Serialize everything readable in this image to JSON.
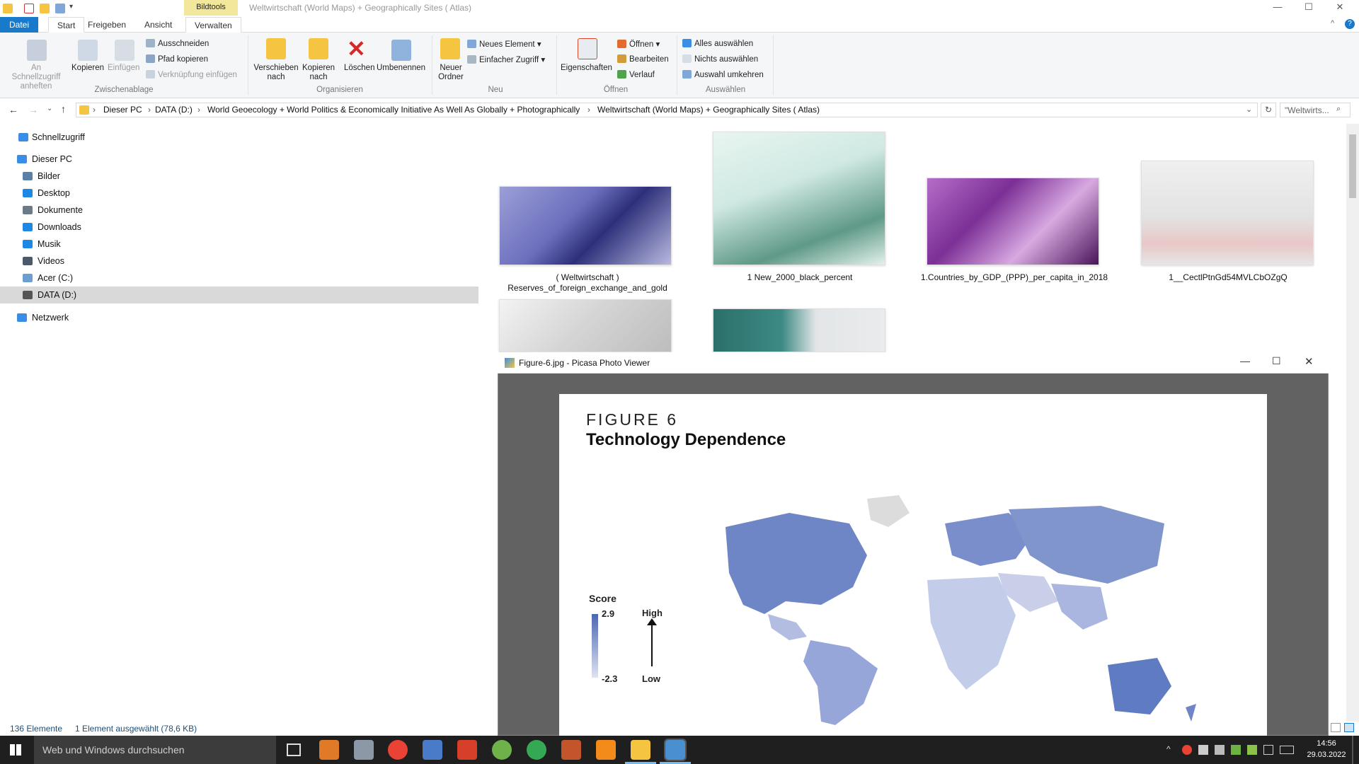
{
  "titlebar": {
    "context_tab": "Bildtools",
    "window_title": "Weltwirtschaft (World Maps) + Geographically Sites ( Atlas)",
    "minimize": "—",
    "maximize": "☐",
    "close": "✕"
  },
  "tabs": [
    "Datei",
    "Start",
    "Freigeben",
    "Ansicht",
    "Verwalten"
  ],
  "ribbon": {
    "pin": "An Schnellzugriff anheften",
    "copy": "Kopieren",
    "paste": "Einfügen",
    "cut": "Ausschneiden",
    "copy_path": "Pfad kopieren",
    "paste_shortcut": "Verknüpfung einfügen",
    "group_clipboard": "Zwischenablage",
    "move_to": "Verschieben nach",
    "copy_to": "Kopieren nach",
    "delete": "Löschen",
    "rename": "Umbenennen",
    "group_organize": "Organisieren",
    "new_folder": "Neuer Ordner",
    "new_item": "Neues Element",
    "easy_access": "Einfacher Zugriff",
    "group_new": "Neu",
    "properties": "Eigenschaften",
    "open": "Öffnen",
    "edit": "Bearbeiten",
    "history": "Verlauf",
    "group_open": "Öffnen",
    "select_all": "Alles auswählen",
    "select_none": "Nichts auswählen",
    "invert_selection": "Auswahl umkehren",
    "group_select": "Auswählen"
  },
  "address": {
    "crumbs": [
      "Dieser PC",
      "DATA (D:)",
      "World Geoecology + World Politics & Economically Initiative As Well As Globally + Photographically",
      "Weltwirtschaft (World Maps) + Geographically Sites ( Atlas)"
    ],
    "search_placeholder": "\"Weltwirts..."
  },
  "nav": {
    "items": [
      {
        "label": "Schnellzugriff",
        "icon": "star-icon",
        "color": "#3a8ee6"
      },
      {
        "label": "Dieser PC",
        "icon": "pc-icon",
        "color": "#3a8ee6"
      },
      {
        "label": "Bilder",
        "icon": "pictures-icon",
        "color": "#5a7fa8"
      },
      {
        "label": "Desktop",
        "icon": "desktop-icon",
        "color": "#1e88e5"
      },
      {
        "label": "Dokumente",
        "icon": "documents-icon",
        "color": "#6d7a87"
      },
      {
        "label": "Downloads",
        "icon": "download-icon",
        "color": "#1e88e5"
      },
      {
        "label": "Musik",
        "icon": "music-icon",
        "color": "#1e88e5"
      },
      {
        "label": "Videos",
        "icon": "videos-icon",
        "color": "#4a5a6a"
      },
      {
        "label": "Acer (C:)",
        "icon": "drive-icon",
        "color": "#6a9fd0"
      },
      {
        "label": "DATA (D:)",
        "icon": "drive-icon",
        "color": "#555555"
      },
      {
        "label": "Netzwerk",
        "icon": "network-icon",
        "color": "#3a8ee6"
      }
    ]
  },
  "files": [
    {
      "caption": "( Weltwirtschaft )\nReserves_of_foreign_exchange_and_gold",
      "tint": "#6b6fb8"
    },
    {
      "caption": "1 New_2000_black_percent",
      "tint": "#cfe9e2"
    },
    {
      "caption": "1.Countries_by_GDP_(PPP)_per_capita_in_2018",
      "tint": "#8c3fa6"
    },
    {
      "caption": "1__CectlPtnGd54MVLCbOZgQ",
      "tint": "#e4e4e4"
    },
    {
      "caption": "",
      "tint": "#d8d8d8"
    },
    {
      "caption": "",
      "tint": "#2c6f6a"
    }
  ],
  "status": {
    "count": "136 Elemente",
    "selection": "1 Element ausgewählt (78,6 KB)"
  },
  "taskbar": {
    "search_placeholder": "Web und Windows durchsuchen",
    "time": "14:56",
    "date": "29.03.2022"
  },
  "picasa": {
    "title": "Figure-6.jpg - Picasa Photo Viewer",
    "figure_number": "FIGURE 6",
    "figure_title": "Technology Dependence",
    "legend_title": "Score",
    "legend_max": "2.9",
    "legend_min": "-2.3",
    "arrow_high": "High",
    "arrow_low": "Low"
  }
}
